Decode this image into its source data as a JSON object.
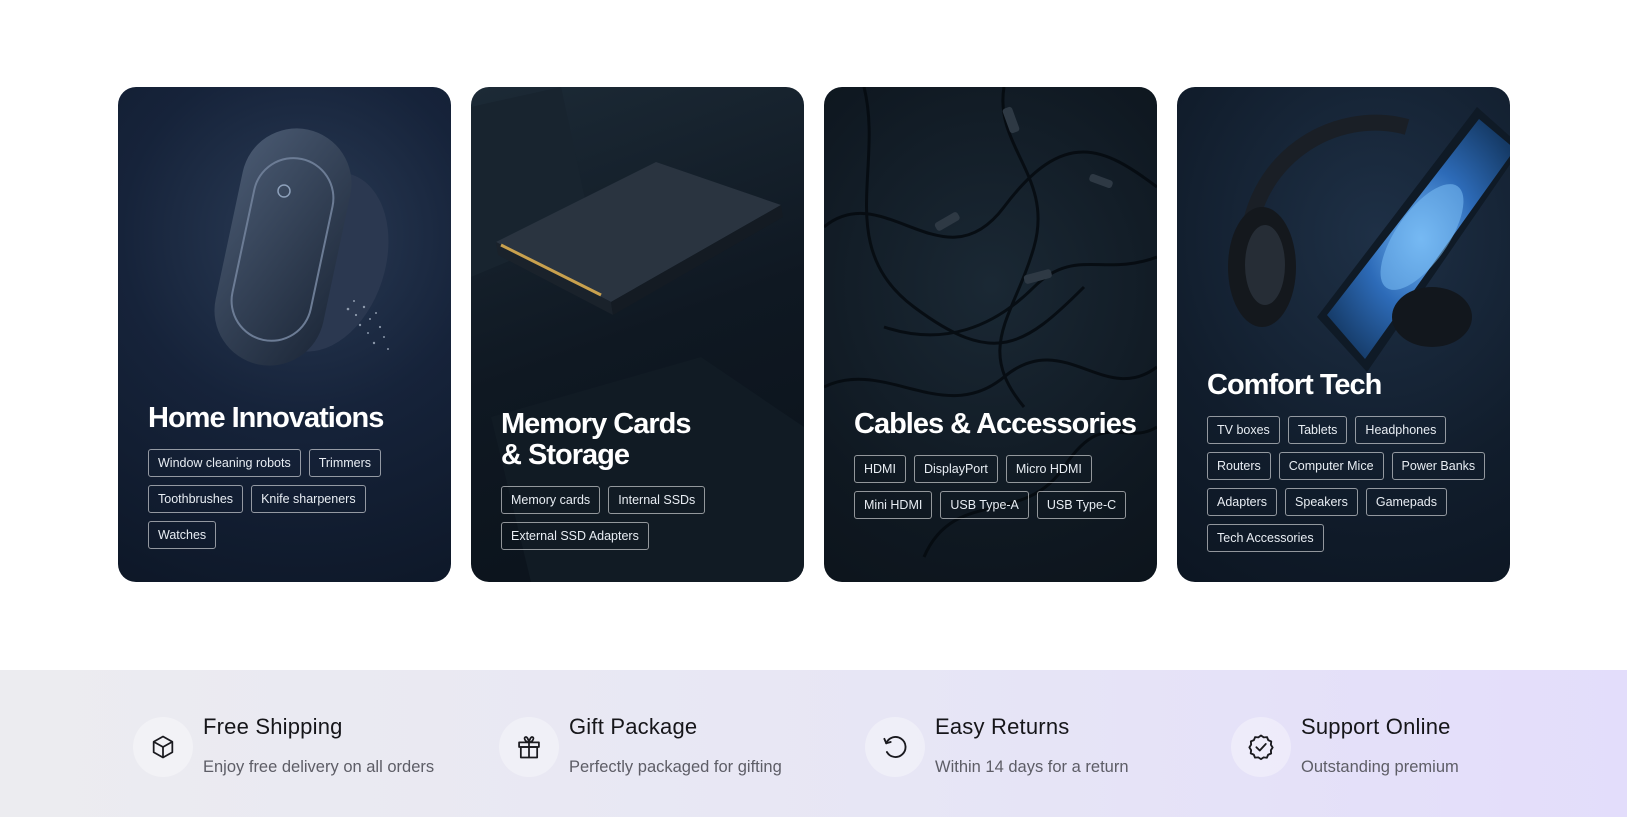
{
  "categories": [
    {
      "title": "Home Innovations",
      "tags": [
        "Window cleaning robots",
        "Trimmers",
        "Toothbrushes",
        "Knife sharpeners",
        "Watches"
      ]
    },
    {
      "title": "Memory Cards\n& Storage",
      "tags": [
        "Memory cards",
        "Internal SSDs",
        "External SSD Adapters"
      ]
    },
    {
      "title": "Cables & Accessories",
      "tags": [
        "HDMI",
        "DisplayPort",
        "Micro HDMI",
        "Mini HDMI",
        "USB Type-A",
        "USB Type-C"
      ]
    },
    {
      "title": "Comfort Tech",
      "tags": [
        "TV boxes",
        "Tablets",
        "Headphones",
        "Routers",
        "Computer Mice",
        "Power Banks",
        "Adapters",
        "Speakers",
        "Gamepads",
        "Tech Accessories"
      ]
    }
  ],
  "features": [
    {
      "icon": "box-icon",
      "title": "Free Shipping",
      "subtitle": "Enjoy free delivery on all orders"
    },
    {
      "icon": "gift-icon",
      "title": "Gift Package",
      "subtitle": "Perfectly packaged for gifting"
    },
    {
      "icon": "return-icon",
      "title": "Easy Returns",
      "subtitle": "Within 14 days for a return"
    },
    {
      "icon": "check-badge-icon",
      "title": "Support Online",
      "subtitle": "Outstanding premium"
    }
  ]
}
